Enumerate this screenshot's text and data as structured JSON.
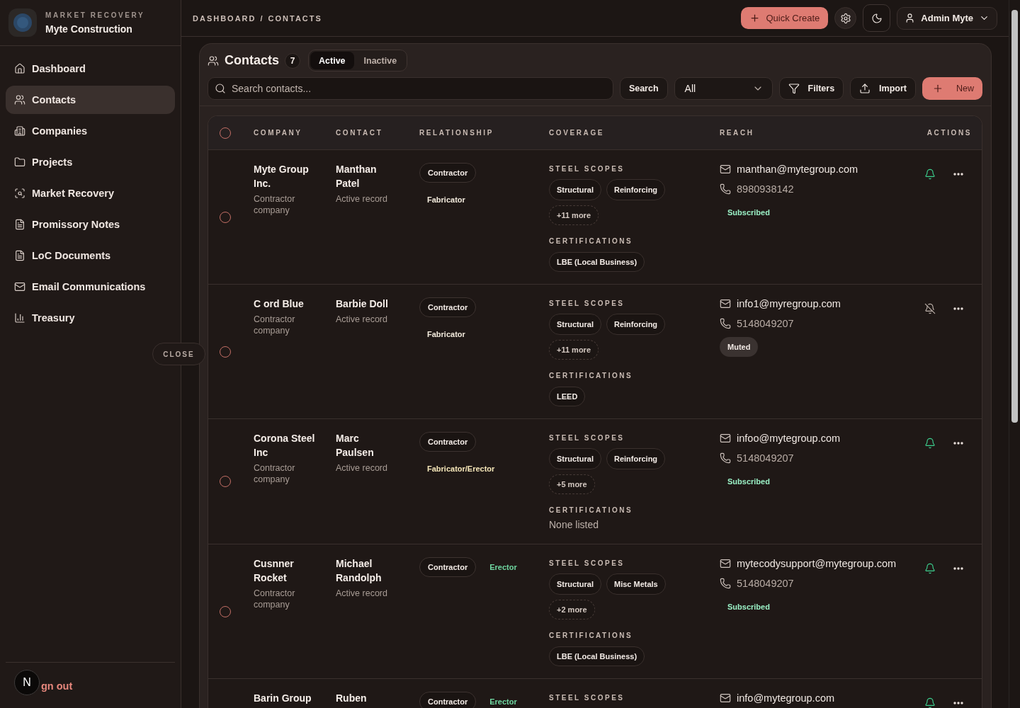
{
  "sidebar": {
    "workspace_label": "MARKET RECOVERY",
    "workspace_name": "Myte Construction",
    "items": [
      {
        "label": "Dashboard",
        "selected": false
      },
      {
        "label": "Contacts",
        "selected": true
      },
      {
        "label": "Companies",
        "selected": false
      },
      {
        "label": "Projects",
        "selected": false
      },
      {
        "label": "Market Recovery",
        "selected": false
      },
      {
        "label": "Promissory Notes",
        "selected": false
      },
      {
        "label": "LoC Documents",
        "selected": false
      },
      {
        "label": "Email Communications",
        "selected": false
      },
      {
        "label": "Treasury",
        "selected": false
      }
    ],
    "close_label": "CLOSE",
    "sign_out": "gn out",
    "dev_badge": "N"
  },
  "topbar": {
    "breadcrumb": [
      "DASHBOARD",
      "CONTACTS"
    ],
    "separator": "/",
    "quick_create": "Quick Create",
    "user": "Admin Myte"
  },
  "panel": {
    "title": "Contacts",
    "count": "7",
    "tabs": [
      {
        "label": "Active",
        "selected": true
      },
      {
        "label": "Inactive",
        "selected": false
      }
    ],
    "search": {
      "placeholder": "Search contacts..."
    },
    "search_button": "Search",
    "filter_select": {
      "value": "All"
    },
    "filters_button": "Filters",
    "import_button": "Import",
    "new_button": "New"
  },
  "table": {
    "select_all": {
      "checked": false
    },
    "columns": [
      "COMPANY",
      "CONTACT",
      "RELATIONSHIP",
      "COVERAGE",
      "REACH",
      "ACTIONS"
    ],
    "rows": [
      {
        "selected": false,
        "company": "Myte Group Inc.",
        "company_type": "Contractor company",
        "contact": "Manthan Patel",
        "contact_status": "Active record",
        "relationship": [
          {
            "label": "Contractor",
            "kind": "pill"
          },
          {
            "label": "Fabricator",
            "kind": "role",
            "color": "#f2eadc"
          }
        ],
        "coverage": {
          "scopes_label": "STEEL SCOPES",
          "scopes": [
            "Structural",
            "Reinforcing"
          ],
          "more": "+11 more",
          "certifications_label": "CERTIFICATIONS",
          "certifications": [
            "LBE (Local Business)"
          ]
        },
        "email": "manthan@mytegroup.com",
        "phone": "8980938142",
        "notifications": {
          "label": "Subscribed",
          "muted": false
        }
      },
      {
        "selected": false,
        "company": "C ord Blue",
        "company_type": "Contractor company",
        "contact": "Barbie Doll",
        "contact_status": "Active record",
        "relationship": [
          {
            "label": "Contractor",
            "kind": "pill"
          },
          {
            "label": "Fabricator",
            "kind": "role",
            "color": "#f2eadc"
          }
        ],
        "coverage": {
          "scopes_label": "STEEL SCOPES",
          "scopes": [
            "Structural",
            "Reinforcing"
          ],
          "more": "+11 more",
          "certifications_label": "CERTIFICATIONS",
          "certifications": [
            "LEED"
          ]
        },
        "email": "info1@myregroup.com",
        "phone": "5148049207",
        "notifications": {
          "label": "Muted",
          "muted": true
        }
      },
      {
        "selected": false,
        "company": "Corona Steel Inc",
        "company_type": "Contractor company",
        "contact": "Marc Paulsen",
        "contact_status": "Active record",
        "relationship": [
          {
            "label": "Contractor",
            "kind": "pill"
          },
          {
            "label": "Fabricator/Erector",
            "kind": "role",
            "color": "#f5e6b8"
          }
        ],
        "coverage": {
          "scopes_label": "STEEL SCOPES",
          "scopes": [
            "Structural",
            "Reinforcing"
          ],
          "more": "+5 more",
          "certifications_label": "CERTIFICATIONS",
          "certifications_note": "None listed"
        },
        "email": "infoo@mytegroup.com",
        "phone": "5148049207",
        "notifications": {
          "label": "Subscribed",
          "muted": false
        }
      },
      {
        "selected": false,
        "company": "Cusnner Rocket",
        "company_type": "Contractor company",
        "contact": "Michael Randolph",
        "contact_status": "Active record",
        "relationship": [
          {
            "label": "Contractor",
            "kind": "pill"
          },
          {
            "label": "Erector",
            "kind": "role",
            "color": "#6fd6a0"
          }
        ],
        "coverage": {
          "scopes_label": "STEEL SCOPES",
          "scopes": [
            "Structural",
            "Misc Metals"
          ],
          "more": "+2 more",
          "certifications_label": "CERTIFICATIONS",
          "certifications": [
            "LBE (Local Business)"
          ]
        },
        "email": "mytecodysupport@mytegroup.com",
        "phone": "5148049207",
        "notifications": {
          "label": "Subscribed",
          "muted": false
        }
      },
      {
        "company": "Barin Group",
        "contact": "Ruben",
        "relationship": [
          {
            "label": "Contractor",
            "kind": "pill"
          },
          {
            "label": "Erector",
            "kind": "role",
            "color": "#6fd6a0"
          }
        ],
        "coverage": {
          "scopes_label": "STEEL SCOPES"
        },
        "email": "info@mytegroup.com",
        "notifications": {
          "muted": false
        }
      }
    ]
  }
}
